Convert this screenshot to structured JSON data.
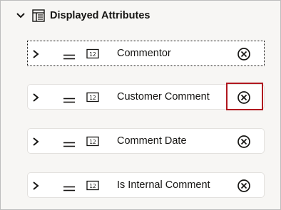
{
  "section": {
    "title": "Displayed Attributes",
    "toggle_icon": "chevron-down-icon",
    "header_icon": "layout-panel-icon"
  },
  "attributes": [
    {
      "label": "Commentor",
      "focused": true
    },
    {
      "label": "Customer Comment",
      "highlighted": true
    },
    {
      "label": "Comment Date"
    },
    {
      "label": "Is Internal Comment"
    }
  ],
  "row_icons": {
    "expand": "chevron-right-icon",
    "drag": "drag-handle-icon",
    "type": "number-type-icon",
    "type_text": "12",
    "remove": "remove-circle-x-icon"
  },
  "colors": {
    "highlight": "#b0171f",
    "background": "#f7f6f4",
    "text": "#161513"
  }
}
